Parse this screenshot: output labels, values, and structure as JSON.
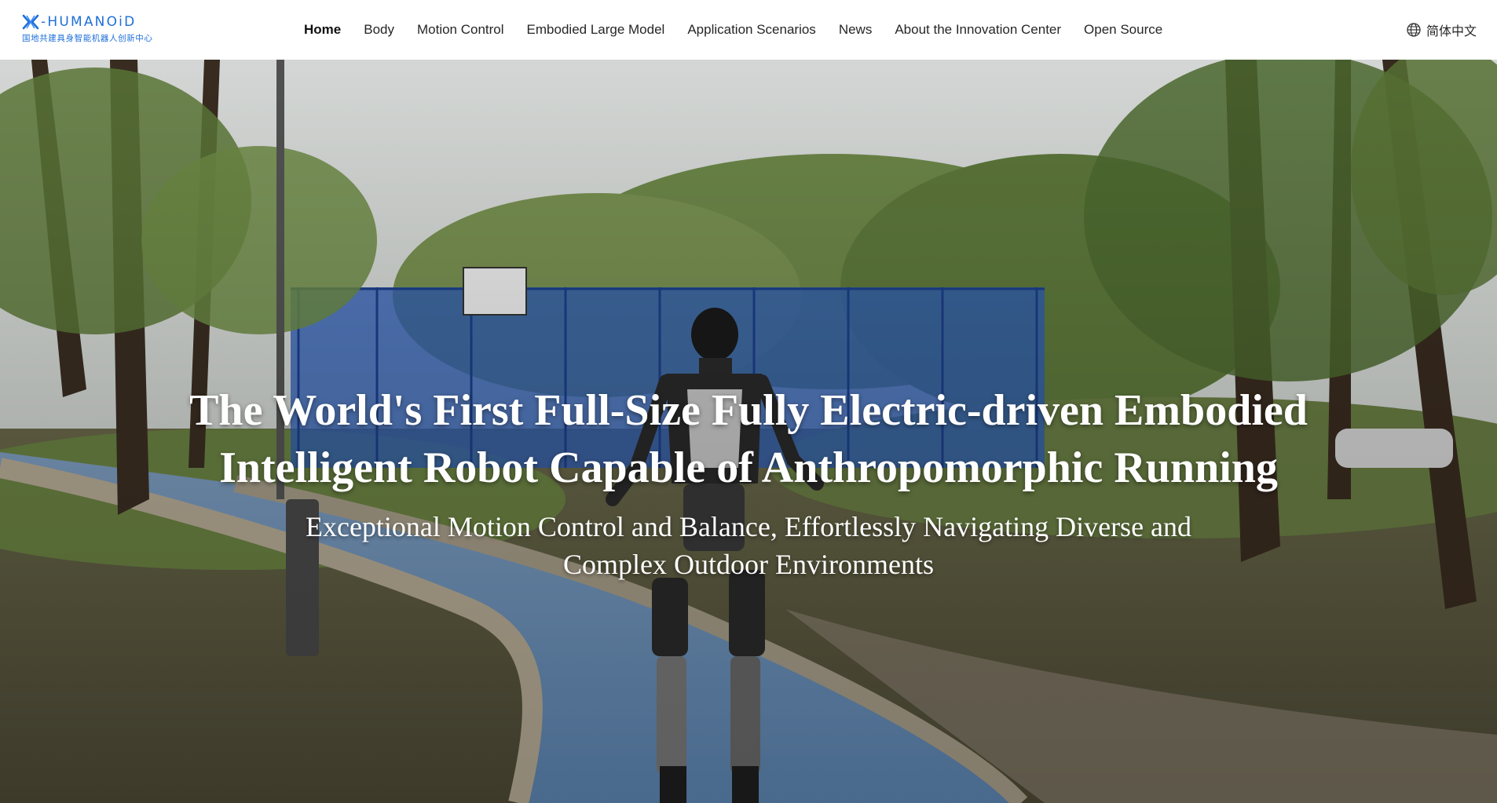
{
  "brand": {
    "logo_word": "-HUMANOiD",
    "logo_sub": "国地共建具身智能机器人创新中心",
    "color": "#1e6fd9"
  },
  "nav": {
    "items": [
      {
        "label": "Home",
        "active": true
      },
      {
        "label": "Body"
      },
      {
        "label": "Motion Control"
      },
      {
        "label": "Embodied Large Model"
      },
      {
        "label": "Application Scenarios"
      },
      {
        "label": "News"
      },
      {
        "label": "About the Innovation Center"
      },
      {
        "label": "Open Source"
      }
    ]
  },
  "language": {
    "icon": "globe-icon",
    "label": "简体中文"
  },
  "hero": {
    "title_lines": [
      "The World's First Full-Size Fully Electric-driven Embodied",
      "Intelligent Robot Capable of Anthropomorphic Running"
    ],
    "subtitle_lines": [
      "Exceptional Motion Control and Balance, Effortlessly Navigating Diverse and",
      "Complex Outdoor Environments"
    ]
  }
}
